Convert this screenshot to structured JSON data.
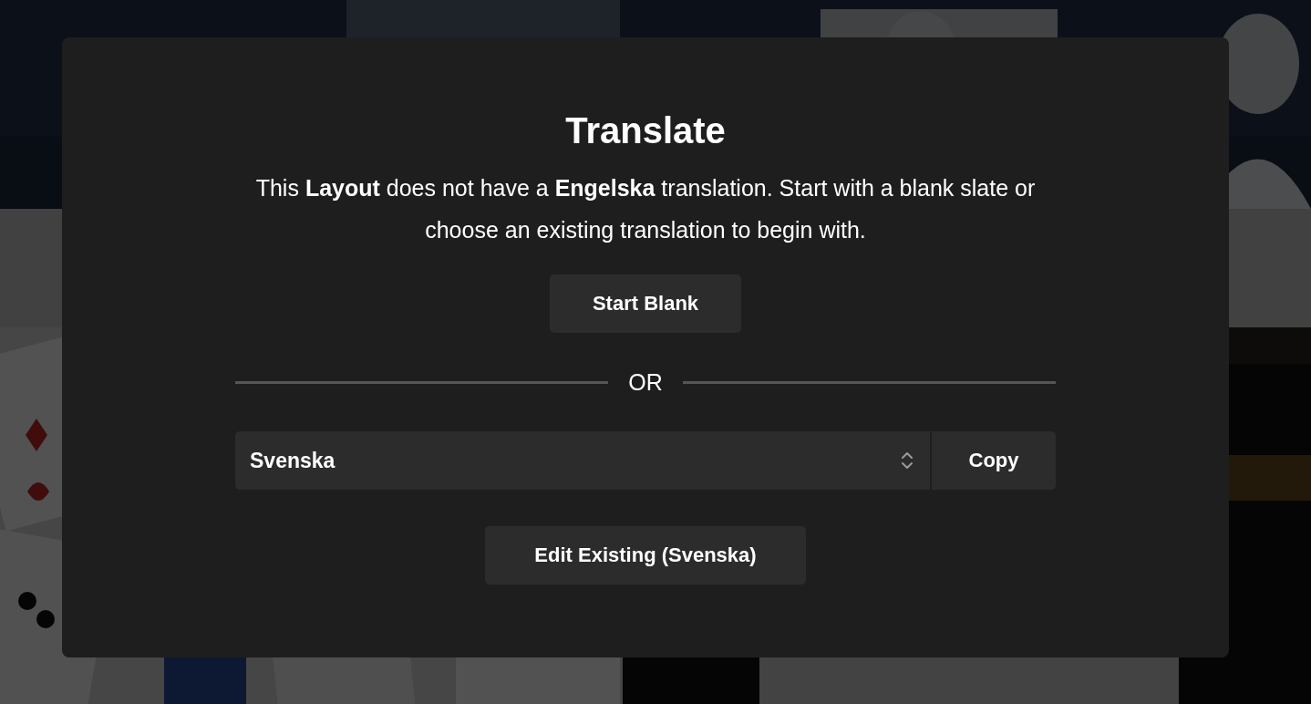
{
  "dialog": {
    "title": "Translate",
    "message": "This **Layout** does not have a **Engelska** translation. Start with a blank slate or choose an existing translation to begin with.",
    "start_button": "Start Blank",
    "divider_label": "OR",
    "language_select": {
      "value": "Svenska"
    },
    "copy_button": "Copy",
    "edit_button": "Edit Existing (Svenska)"
  }
}
